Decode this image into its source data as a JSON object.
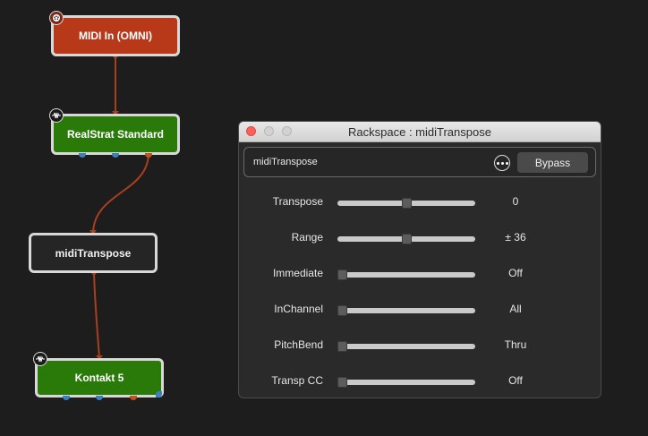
{
  "nodes": [
    {
      "label": "MIDI In (OMNI)",
      "badge_icon": "midi-din-icon"
    },
    {
      "label": "RealStrat Standard",
      "badge_icon": "waveform-icon"
    },
    {
      "label": "midiTranspose"
    },
    {
      "label": "Kontakt 5",
      "badge_icon": "waveform-icon"
    }
  ],
  "colors": {
    "background": "#1d1d1d",
    "midi_node": "#b8391a",
    "plugin_node": "#2a7a0a",
    "midi_node_dark": "#252525",
    "connection": "#a8401f",
    "audio_port": "#3e7fbf",
    "midi_port": "#c4521f"
  },
  "window": {
    "title": "Rackspace : midiTranspose",
    "plugin_name": "midiTranspose",
    "more_icon": "ellipsis-circle-icon",
    "bypass_label": "Bypass",
    "params": [
      {
        "label": "Transpose",
        "value": "0",
        "level": 0.5
      },
      {
        "label": "Range",
        "value": "± 36",
        "level": 0.5
      },
      {
        "label": "Immediate",
        "value": "Off",
        "level": 0
      },
      {
        "label": "InChannel",
        "value": "All",
        "level": 0
      },
      {
        "label": "PitchBend",
        "value": "Thru",
        "level": 0
      },
      {
        "label": "Transp CC",
        "value": "Off",
        "level": 0
      }
    ]
  }
}
